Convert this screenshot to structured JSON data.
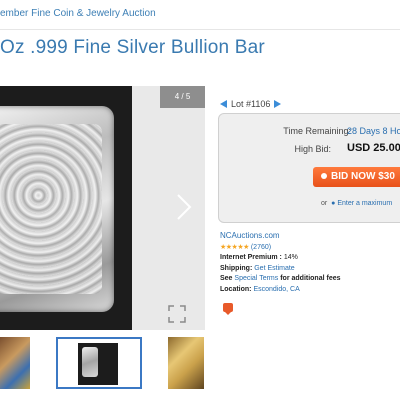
{
  "breadcrumb": {
    "text": "ember Fine Coin & Jewelry Auction"
  },
  "listing": {
    "title": "Oz .999 Fine Silver Bullion Bar"
  },
  "gallery": {
    "counter": "4 / 5"
  },
  "lot": {
    "label": "Lot #1106"
  },
  "bidding": {
    "time_remaining_label": "Time Remaining:",
    "time_remaining_value": "28 Days 8 Ho",
    "high_bid_label": "High Bid:",
    "high_bid_value": "USD 25.00",
    "bid_button_label": "BID NOW $30",
    "or_text": "or",
    "max_bid_link": "Enter a maximum"
  },
  "seller": {
    "name": "NCAuctions.com",
    "stars": "★★★★★",
    "rating_count": "(2760)",
    "premium_label": "Internet Premium :",
    "premium_value": "14%",
    "shipping_label": "Shipping:",
    "shipping_link": "Get Estimate",
    "fees_prefix": "See",
    "fees_link": "Special Terms",
    "fees_suffix": "for additional fees",
    "location_label": "Location:",
    "location_value": "Escondido, CA"
  },
  "colors": {
    "link": "#3a7ab0",
    "bid_button": "#e8511a",
    "thumb_border": "#3b78c4"
  },
  "icons": [
    "nav-left-icon",
    "nav-right-icon",
    "next-image-icon",
    "expand-icon",
    "message-icon"
  ]
}
